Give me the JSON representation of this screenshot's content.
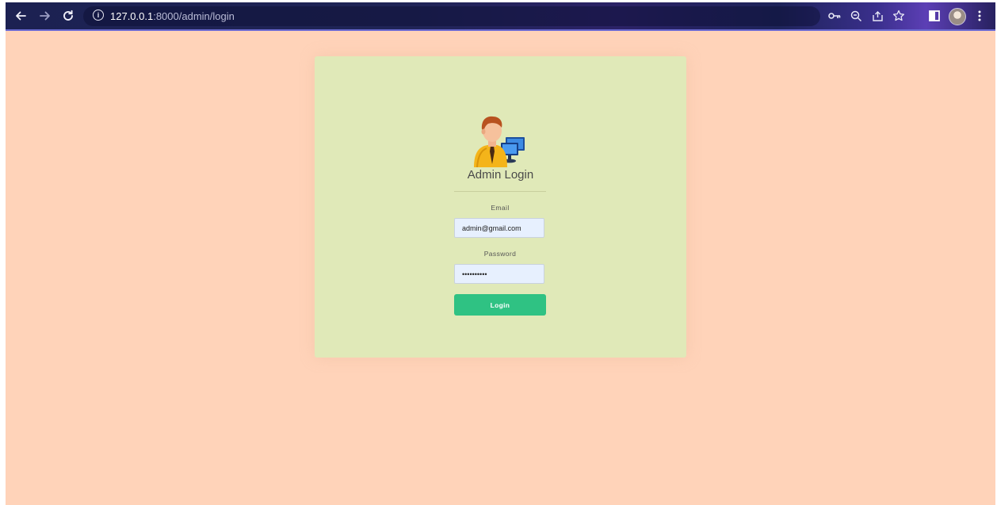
{
  "browser": {
    "url_host": "127.0.0.1",
    "url_rest": ":8000/admin/login",
    "icons": {
      "back": "back-arrow-icon",
      "forward": "forward-arrow-icon",
      "reload": "reload-icon",
      "site_info": "info-icon",
      "password": "key-icon",
      "zoom": "zoom-icon",
      "share": "share-icon",
      "bookmark": "star-icon",
      "side_panel": "side-panel-icon",
      "profile": "profile-avatar",
      "menu": "kebab-menu-icon"
    }
  },
  "login": {
    "title": "Admin Login",
    "email_label": "Email",
    "email_value": "admin@gmail.com",
    "password_label": "Password",
    "password_value": "1234567890",
    "button_label": "Login"
  },
  "colors": {
    "page_background": "#ffd3b9",
    "card_background": "#e0e9b8",
    "button": "#2fc283",
    "input_background": "#e7f0fe"
  }
}
